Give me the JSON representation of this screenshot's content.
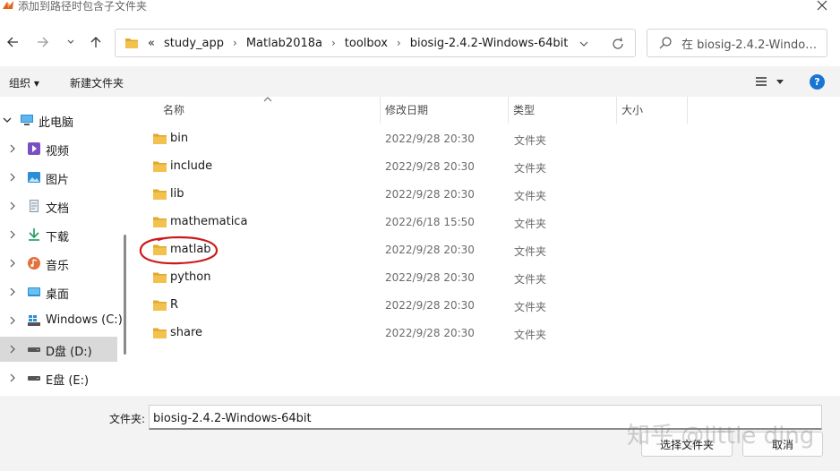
{
  "window": {
    "title": "添加到路径时包含子文件夹"
  },
  "nav": {
    "back_icon": "back-arrow-icon",
    "forward_icon": "forward-arrow-icon",
    "recent_icon": "chevron-down-icon",
    "up_icon": "up-arrow-icon"
  },
  "address": {
    "overflow": "«",
    "crumbs": [
      "study_app",
      "Matlab2018a",
      "toolbox",
      "biosig-2.4.2-Windows-64bit"
    ],
    "separator": "›"
  },
  "search": {
    "placeholder": "在 biosig-2.4.2-Windows-..."
  },
  "toolbar": {
    "organize": "组织 ▾",
    "new_folder": "新建文件夹"
  },
  "sidebar": {
    "items": [
      {
        "label": "此电脑",
        "icon": "computer-icon",
        "expanded": true
      },
      {
        "label": "视频",
        "icon": "video-icon"
      },
      {
        "label": "图片",
        "icon": "pictures-icon"
      },
      {
        "label": "文档",
        "icon": "documents-icon"
      },
      {
        "label": "下载",
        "icon": "downloads-icon"
      },
      {
        "label": "音乐",
        "icon": "music-icon"
      },
      {
        "label": "桌面",
        "icon": "desktop-icon"
      },
      {
        "label": "Windows (C:)",
        "icon": "windows-drive-icon"
      },
      {
        "label": "D盘 (D:)",
        "icon": "drive-icon",
        "selected": true
      },
      {
        "label": "E盘 (E:)",
        "icon": "drive-icon"
      }
    ]
  },
  "columns": {
    "name": "名称",
    "date": "修改日期",
    "type": "类型",
    "size": "大小"
  },
  "files": [
    {
      "name": "bin",
      "date": "2022/9/28 20:30",
      "type": "文件夹"
    },
    {
      "name": "include",
      "date": "2022/9/28 20:30",
      "type": "文件夹"
    },
    {
      "name": "lib",
      "date": "2022/9/28 20:30",
      "type": "文件夹"
    },
    {
      "name": "mathematica",
      "date": "2022/6/18 15:50",
      "type": "文件夹"
    },
    {
      "name": "matlab",
      "date": "2022/9/28 20:30",
      "type": "文件夹",
      "annotated": true
    },
    {
      "name": "python",
      "date": "2022/9/28 20:30",
      "type": "文件夹"
    },
    {
      "name": "R",
      "date": "2022/9/28 20:30",
      "type": "文件夹"
    },
    {
      "name": "share",
      "date": "2022/9/28 20:30",
      "type": "文件夹"
    }
  ],
  "footer": {
    "folder_label": "文件夹:",
    "folder_value": "biosig-2.4.2-Windows-64bit",
    "select_button": "选择文件夹",
    "cancel_button": "取消"
  },
  "watermark": "知乎 @little ding",
  "colors": {
    "folder": "#f2c14e",
    "folder_dark": "#e0a82e",
    "accent": "#1a74d2",
    "annotation": "#cc1a1a",
    "selected_bg": "#d9d9d9"
  }
}
